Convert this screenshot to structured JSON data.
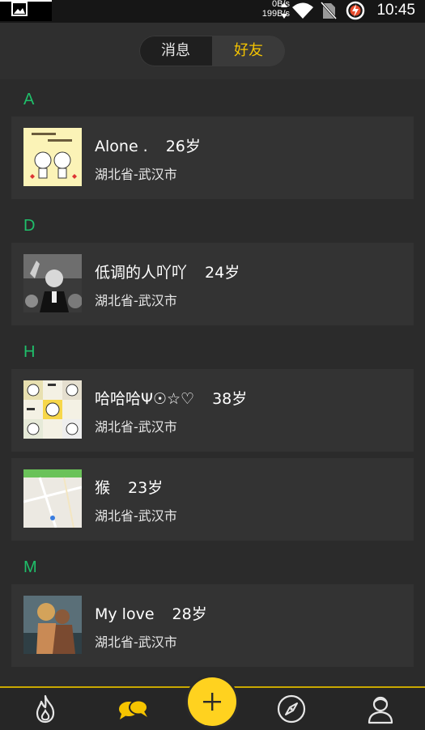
{
  "status_bar": {
    "speed_up": "0B/s",
    "speed_down": "199B/s",
    "time": "10:45",
    "icons": [
      "image-icon",
      "wifi-icon",
      "no-sim-icon",
      "battery-charging-icon"
    ]
  },
  "tabs": {
    "messages": "消息",
    "friends": "好友",
    "active": "friends"
  },
  "sections": [
    {
      "letter": "A",
      "friends": [
        {
          "name": "Alone .",
          "age": "26岁",
          "location": "湖北省-武汉市"
        }
      ]
    },
    {
      "letter": "D",
      "friends": [
        {
          "name": "低调的人吖吖",
          "age": "24岁",
          "location": "湖北省-武汉市"
        }
      ]
    },
    {
      "letter": "H",
      "friends": [
        {
          "name": "哈哈哈Ψ☉☆♡",
          "age": "38岁",
          "location": "湖北省-武汉市"
        },
        {
          "name": "猴",
          "age": "23岁",
          "location": "湖北省-武汉市"
        }
      ]
    },
    {
      "letter": "M",
      "friends": [
        {
          "name": "My love",
          "age": "28岁",
          "location": "湖北省-武汉市"
        }
      ]
    }
  ],
  "bottom_nav": {
    "items": [
      "fire-icon",
      "chat-bubbles-icon",
      "add-icon",
      "compass-icon",
      "profile-icon"
    ],
    "active": "chat-bubbles-icon"
  },
  "colors": {
    "accent": "#f5c400",
    "section_letter": "#1fbf6a",
    "background": "#2b2b2b",
    "card": "#333333"
  }
}
